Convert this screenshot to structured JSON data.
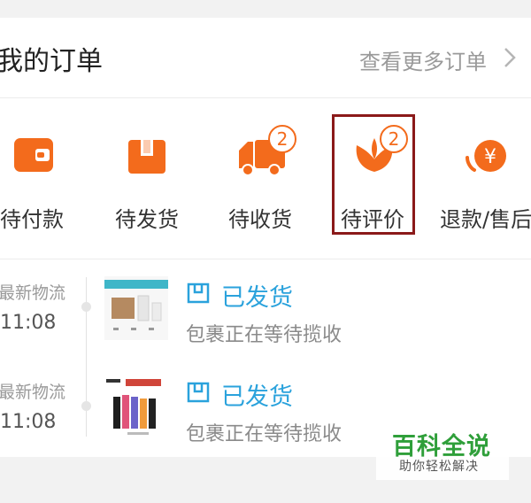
{
  "header": {
    "title": "我的订单",
    "more_label": "查看更多订单"
  },
  "order_tabs": [
    {
      "label": "待付款",
      "icon": "wallet-icon"
    },
    {
      "label": "待发货",
      "icon": "package-icon"
    },
    {
      "label": "待收货",
      "icon": "truck-icon",
      "badge": "2"
    },
    {
      "label": "待评价",
      "icon": "flower-icon",
      "badge": "2"
    },
    {
      "label": "退款/售后",
      "icon": "refund-yen-icon"
    }
  ],
  "logistics_items": [
    {
      "time_label": "最新物流",
      "time": "11:08",
      "status": "已发货",
      "status_icon": "parcel-status-icon",
      "description": "包裹正在等待揽收"
    },
    {
      "time_label": "最新物流",
      "time": "11:08",
      "status": "已发货",
      "status_icon": "parcel-status-icon",
      "description": "包裹正在等待揽收"
    }
  ],
  "watermark": {
    "title": "百科全说",
    "subtitle": "助你轻松解决"
  },
  "colors": {
    "accent_orange": "#f36b1c",
    "status_blue": "#2aa2dc",
    "highlight_border": "#8b1a1a"
  }
}
